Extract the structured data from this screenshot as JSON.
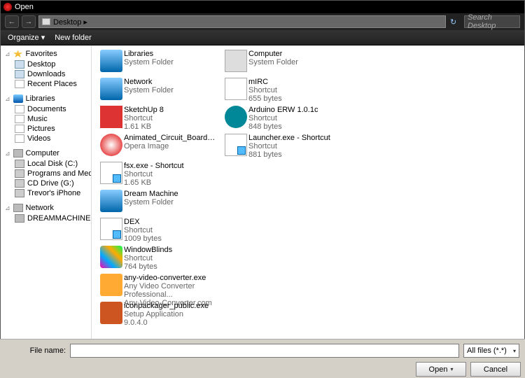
{
  "window": {
    "title": "Open"
  },
  "nav": {
    "back": "←",
    "fwd": "→",
    "location": "Desktop  ▸",
    "search_placeholder": "Search Desktop",
    "refresh": "↻"
  },
  "toolbar": {
    "organize": "Organize ▾",
    "newfolder": "New folder"
  },
  "sidebar": {
    "groups": [
      {
        "name": "favorites",
        "label": "Favorites",
        "icon": "i-fav",
        "items": [
          {
            "label": "Desktop",
            "icon": "i-desk"
          },
          {
            "label": "Downloads",
            "icon": "i-dl"
          },
          {
            "label": "Recent Places",
            "icon": "i-doc"
          }
        ]
      },
      {
        "name": "libraries",
        "label": "Libraries",
        "icon": "i-lib",
        "items": [
          {
            "label": "Documents",
            "icon": "i-doc"
          },
          {
            "label": "Music",
            "icon": "i-mus"
          },
          {
            "label": "Pictures",
            "icon": "i-pic"
          },
          {
            "label": "Videos",
            "icon": "i-vid"
          }
        ]
      },
      {
        "name": "computer",
        "label": "Computer",
        "icon": "i-comp",
        "items": [
          {
            "label": "Local Disk (C:)",
            "icon": "i-drv"
          },
          {
            "label": "Programs and Media",
            "icon": "i-drv"
          },
          {
            "label": "CD Drive (G:)",
            "icon": "i-drv"
          },
          {
            "label": "Trevor's iPhone",
            "icon": "i-drv"
          }
        ]
      },
      {
        "name": "network",
        "label": "Network",
        "icon": "i-net",
        "items": [
          {
            "label": "DREAMMACHINE",
            "icon": "i-comp"
          }
        ]
      }
    ]
  },
  "files": [
    {
      "name": "Libraries",
      "type": "System Folder",
      "size": "",
      "thumb": "t-fld"
    },
    {
      "name": "Network",
      "type": "System Folder",
      "size": "",
      "thumb": "t-fld"
    },
    {
      "name": "SketchUp 8",
      "type": "Shortcut",
      "size": "1.61 KB",
      "thumb": "t-su"
    },
    {
      "name": "Animated_Circuit_Board_by_mizerydearia.gif",
      "type": "Opera Image",
      "size": "",
      "thumb": "t-op"
    },
    {
      "name": "fsx.exe - Shortcut",
      "type": "Shortcut",
      "size": "1.65 KB",
      "thumb": "t-sc"
    },
    {
      "name": "Dream Machine",
      "type": "System Folder",
      "size": "",
      "thumb": "t-fld"
    },
    {
      "name": "DEX",
      "type": "Shortcut",
      "size": "1009 bytes",
      "thumb": "t-sc"
    },
    {
      "name": "WindowBlinds",
      "type": "Shortcut",
      "size": "764 bytes",
      "thumb": "t-wb"
    },
    {
      "name": "any-video-converter.exe",
      "type": "Any Video Converter Professional...",
      "size": "Any-Video-Converter.com",
      "thumb": "t-avc"
    },
    {
      "name": "iconpackager_public.exe",
      "type": "Setup Application",
      "size": "9.0.4.0",
      "thumb": "t-ip"
    },
    {
      "name": "Computer",
      "type": "System Folder",
      "size": "",
      "thumb": "t-comp"
    },
    {
      "name": "mIRC",
      "type": "Shortcut",
      "size": "655 bytes",
      "thumb": "t-mirc"
    },
    {
      "name": "Arduino ERW 1.0.1c",
      "type": "Shortcut",
      "size": "848 bytes",
      "thumb": "t-ard"
    },
    {
      "name": "Launcher.exe - Shortcut",
      "type": "Shortcut",
      "size": "881 bytes",
      "thumb": "t-sc"
    }
  ],
  "footer": {
    "filename_label": "File name:",
    "filename_value": "",
    "filter": "All files (*.*)",
    "open_btn": "Open",
    "cancel_btn": "Cancel"
  }
}
